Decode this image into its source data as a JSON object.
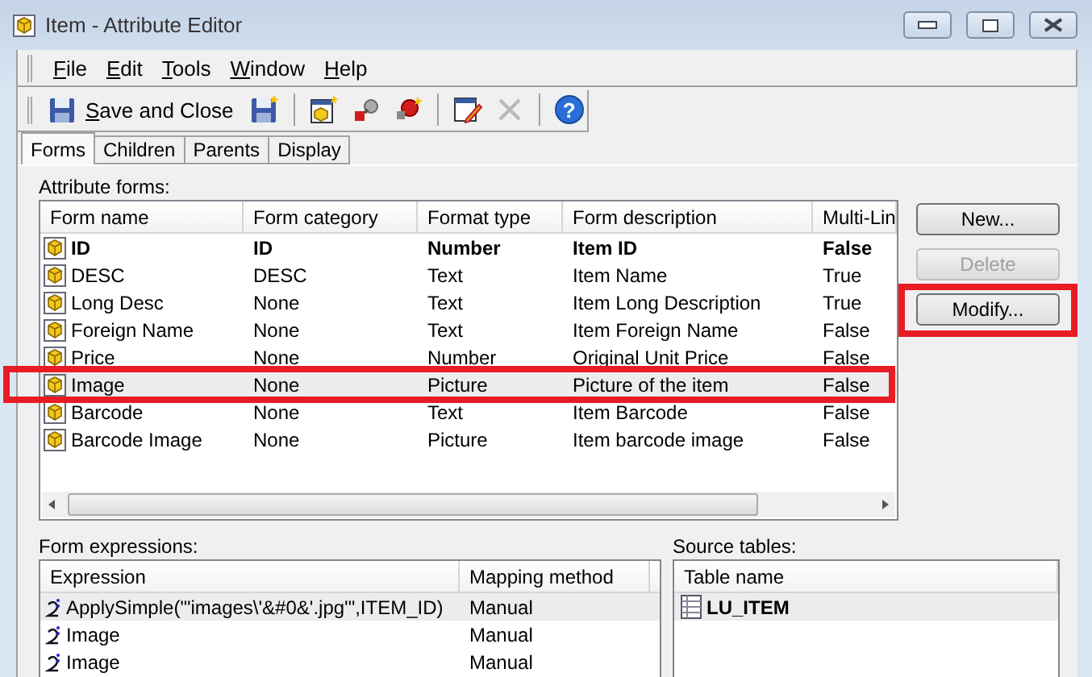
{
  "window": {
    "title": "Item - Attribute Editor"
  },
  "menu": [
    {
      "label": "File",
      "underline_first": true
    },
    {
      "label": "Edit",
      "underline_first": true
    },
    {
      "label": "Tools",
      "underline_first": true
    },
    {
      "label": "Window",
      "underline_first": true
    },
    {
      "label": "Help",
      "underline_first": true
    }
  ],
  "toolbar": {
    "save_button": {
      "label": "Save and Close",
      "underline_first": true
    },
    "groups": [
      {
        "tools": [
          {
            "kind": "save-as",
            "disabled": false
          }
        ]
      },
      {
        "tools": [
          {
            "kind": "new-form",
            "disabled": false
          },
          {
            "kind": "link",
            "disabled": false
          },
          {
            "kind": "link-new",
            "disabled": false
          }
        ]
      },
      {
        "tools": [
          {
            "kind": "edit",
            "disabled": false
          },
          {
            "kind": "delete",
            "disabled": true
          }
        ]
      },
      {
        "tools": [
          {
            "kind": "help",
            "disabled": false,
            "glyph": "?"
          }
        ]
      }
    ]
  },
  "tabs": [
    {
      "label": "Forms",
      "selected": true
    },
    {
      "label": "Children",
      "selected": false
    },
    {
      "label": "Parents",
      "selected": false
    },
    {
      "label": "Display",
      "selected": false
    }
  ],
  "attribute_forms": {
    "label": "Attribute forms:",
    "columns": [
      "Form name",
      "Form category",
      "Format type",
      "Form description",
      "Multi-Lin"
    ],
    "rows": [
      {
        "cells": [
          "ID",
          "ID",
          "Number",
          "Item ID",
          "False"
        ],
        "bold": true,
        "selected": false,
        "annotated": false
      },
      {
        "cells": [
          "DESC",
          "DESC",
          "Text",
          "Item Name",
          "True"
        ],
        "bold": false,
        "selected": false,
        "annotated": false
      },
      {
        "cells": [
          "Long Desc",
          "None",
          "Text",
          "Item Long Description",
          "True"
        ],
        "bold": false,
        "selected": false,
        "annotated": false
      },
      {
        "cells": [
          "Foreign Name",
          "None",
          "Text",
          "Item Foreign Name",
          "False"
        ],
        "bold": false,
        "selected": false,
        "annotated": false
      },
      {
        "cells": [
          "Price",
          "None",
          "Number",
          "Original Unit Price",
          "False"
        ],
        "bold": false,
        "selected": false,
        "annotated": false
      },
      {
        "cells": [
          "Image",
          "None",
          "Picture",
          "Picture of the item",
          "False"
        ],
        "bold": false,
        "selected": true,
        "annotated": true
      },
      {
        "cells": [
          "Barcode",
          "None",
          "Text",
          "Item Barcode",
          "False"
        ],
        "bold": false,
        "selected": false,
        "annotated": false
      },
      {
        "cells": [
          "Barcode Image",
          "None",
          "Picture",
          "Item barcode image",
          "False"
        ],
        "bold": false,
        "selected": false,
        "annotated": false
      }
    ]
  },
  "buttons": [
    {
      "label": "New...",
      "disabled": false,
      "annotated": false
    },
    {
      "label": "Delete",
      "disabled": true,
      "annotated": false
    },
    {
      "label": "Modify...",
      "disabled": false,
      "annotated": true
    }
  ],
  "form_expressions": {
    "label": "Form expressions:",
    "columns": [
      "Expression",
      "Mapping method"
    ],
    "rows": [
      {
        "cells": [
          "ApplySimple(\"'images\\'&#0&'.jpg'\",ITEM_ID)",
          "Manual"
        ],
        "selected": true
      },
      {
        "cells": [
          "Image",
          "Manual"
        ],
        "selected": false
      },
      {
        "cells": [
          "Image",
          "Manual"
        ],
        "selected": false
      }
    ]
  },
  "source_tables": {
    "label": "Source tables:",
    "columns": [
      "Table name"
    ],
    "rows": [
      {
        "name": "LU_ITEM",
        "selected": true
      }
    ]
  }
}
